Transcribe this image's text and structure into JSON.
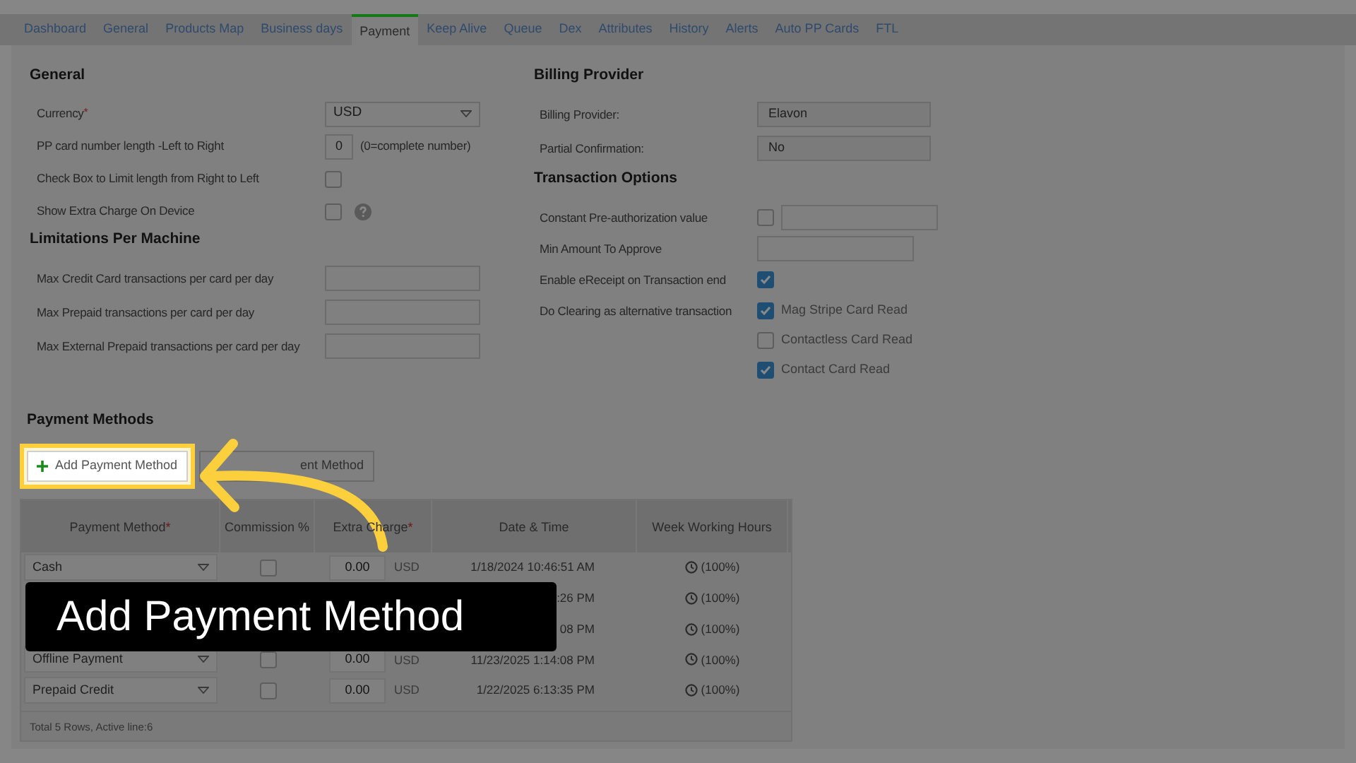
{
  "tabs": [
    {
      "label": "Dashboard",
      "selected": false
    },
    {
      "label": "General",
      "selected": false
    },
    {
      "label": "Products Map",
      "selected": false
    },
    {
      "label": "Business days",
      "selected": false
    },
    {
      "label": "Payment",
      "selected": true
    },
    {
      "label": "Keep Alive",
      "selected": false
    },
    {
      "label": "Queue",
      "selected": false
    },
    {
      "label": "Dex",
      "selected": false
    },
    {
      "label": "Attributes",
      "selected": false
    },
    {
      "label": "History",
      "selected": false
    },
    {
      "label": "Alerts",
      "selected": false
    },
    {
      "label": "Auto PP Cards",
      "selected": false
    },
    {
      "label": "FTL",
      "selected": false
    }
  ],
  "general": {
    "title": "General",
    "fields": [
      {
        "kind": "select",
        "label": "Currency",
        "required_mark": "*",
        "value": "USD"
      },
      {
        "kind": "number",
        "label": "PP card number length -Left to Right",
        "value": "0",
        "note": "(0=complete number)"
      },
      {
        "kind": "checkbox",
        "label": "Check Box to Limit length from Right to Left",
        "checked": false
      },
      {
        "kind": "checkbox",
        "label": "Show Extra Charge On Device",
        "checked": false,
        "help": true
      }
    ]
  },
  "limitations": {
    "title": "Limitations Per Machine",
    "fields": [
      {
        "label": "Max Credit Card transactions per card per day"
      },
      {
        "label": "Max Prepaid transactions per card per day"
      },
      {
        "label": "Max External Prepaid transactions per card per day"
      }
    ]
  },
  "billing": {
    "title": "Billing Provider",
    "fields": [
      {
        "label": "Billing Provider:",
        "value": "Elavon"
      },
      {
        "label": "Partial Confirmation:",
        "value": "No"
      }
    ]
  },
  "transaction_options": {
    "title": "Transaction Options",
    "rows": [
      {
        "kind": "checkbox_input",
        "label": "Constant Pre-authorization value",
        "checked": false
      },
      {
        "kind": "input",
        "label": "Min Amount To Approve"
      },
      {
        "kind": "checkbox",
        "label": "Enable eReceipt on Transaction end",
        "checked": true
      },
      {
        "kind": "checkbox_list",
        "label": "Do Clearing as alternative transaction",
        "options": [
          {
            "label": "Mag Stripe Card Read",
            "checked": true
          },
          {
            "label": "Contactless Card Read",
            "checked": false
          },
          {
            "label": "Contact Card Read",
            "checked": true
          }
        ]
      }
    ]
  },
  "payment_methods": {
    "title": "Payment Methods",
    "buttons": [
      {
        "kind": "add",
        "label": "Add Payment Method",
        "highlighted": true
      },
      {
        "kind": "plain",
        "label": "ent Method",
        "highlighted": false
      }
    ],
    "table": {
      "columns": [
        {
          "label": "Payment Method",
          "required_mark": "*"
        },
        {
          "label": "Commission %"
        },
        {
          "label": "Extra Charge",
          "required_mark": "*"
        },
        {
          "label": "Date & Time"
        },
        {
          "label": "Week Working Hours"
        }
      ],
      "rows": [
        {
          "method": "Cash",
          "commission_checked": false,
          "extra": "0.00",
          "currency": "USD",
          "date": "1/18/2024 10:46:51 AM",
          "hours": "(100%)"
        },
        {
          "date": ":26 PM",
          "hours": "(100%)"
        },
        {
          "date": "08 PM",
          "hours": "(100%)"
        },
        {
          "method": "Offline Payment",
          "commission_checked": false,
          "extra": "0.00",
          "currency": "USD",
          "date": "11/23/2025 1:14:08 PM",
          "hours": "(100%)"
        },
        {
          "method": "Prepaid Credit",
          "commission_checked": false,
          "extra": "0.00",
          "currency": "USD",
          "date": "1/22/2025 6:13:35 PM",
          "hours": "(100%)"
        }
      ],
      "footer": "Total 5 Rows, Active line:6"
    }
  },
  "caption": "Add Payment Method"
}
